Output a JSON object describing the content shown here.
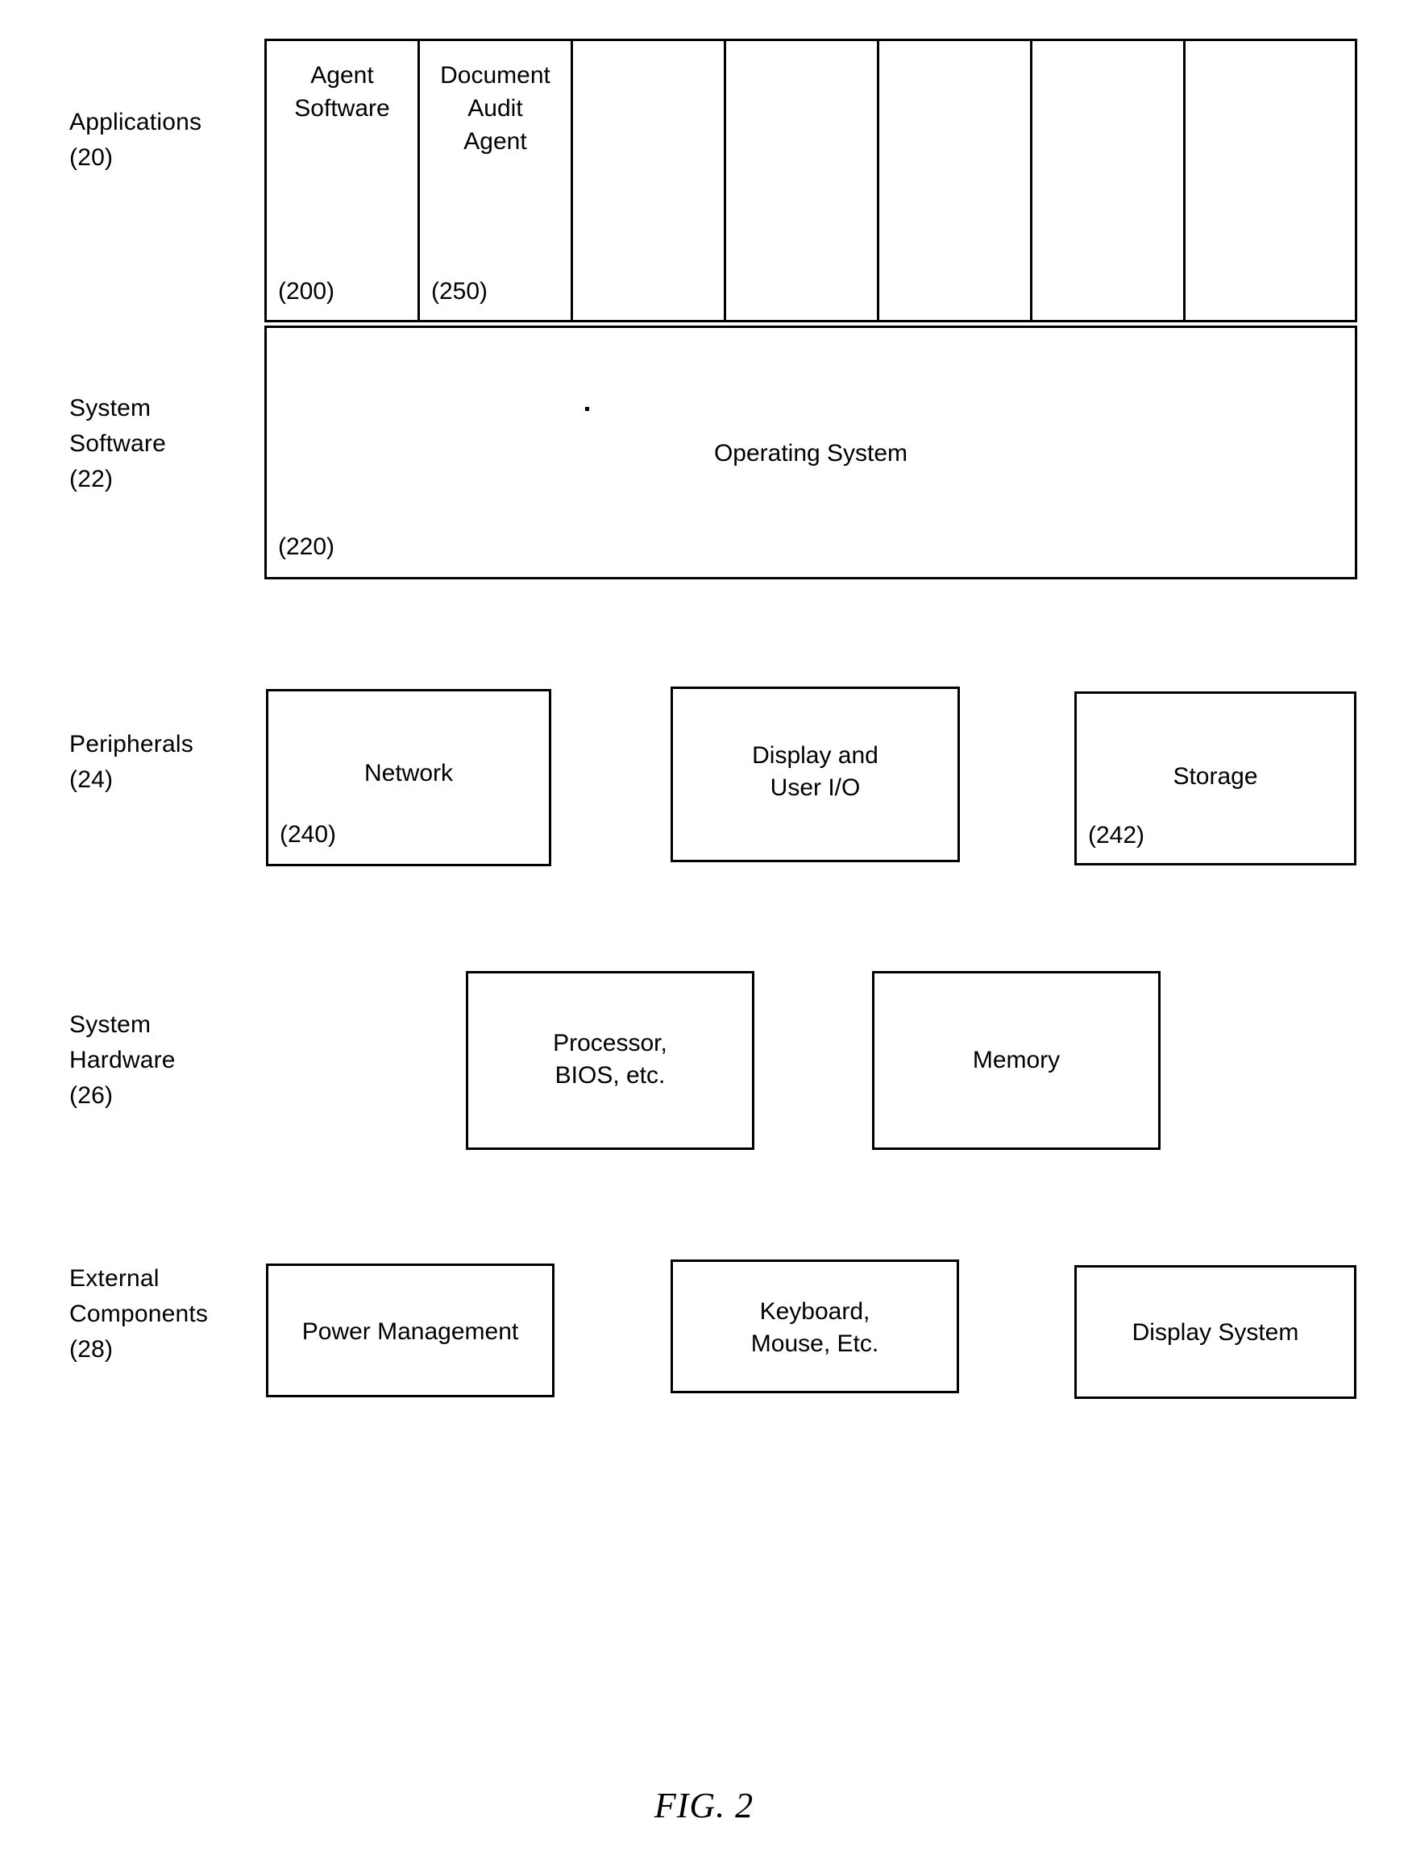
{
  "figure": {
    "caption": "FIG. 2"
  },
  "rows": [
    {
      "id": "applications",
      "label": "Applications\n(20)"
    },
    {
      "id": "system-software",
      "label": "System\nSoftware\n(22)"
    },
    {
      "id": "peripherals",
      "label": "Peripherals\n(24)"
    },
    {
      "id": "system-hardware",
      "label": "System\nHardware\n(26)"
    },
    {
      "id": "external-components",
      "label": "External\nComponents\n(28)"
    }
  ],
  "applications": {
    "cells": [
      {
        "title": "Agent\nSoftware",
        "ref": "(200)"
      },
      {
        "title": "Document\nAudit\nAgent",
        "ref": "(250)"
      },
      {
        "title": "",
        "ref": ""
      },
      {
        "title": "",
        "ref": ""
      },
      {
        "title": "",
        "ref": ""
      },
      {
        "title": "",
        "ref": ""
      },
      {
        "title": "",
        "ref": ""
      }
    ]
  },
  "system_software": {
    "os": {
      "title": "Operating System",
      "ref": "(220)"
    }
  },
  "peripherals": {
    "boxes": [
      {
        "title": "Network",
        "ref": "(240)"
      },
      {
        "title": "Display and\nUser I/O",
        "ref": ""
      },
      {
        "title": "Storage",
        "ref": "(242)"
      }
    ]
  },
  "system_hardware": {
    "boxes": [
      {
        "title": "Processor,\nBIOS, etc.",
        "ref": ""
      },
      {
        "title": "Memory",
        "ref": ""
      }
    ]
  },
  "external_components": {
    "boxes": [
      {
        "title": "Power Management",
        "ref": ""
      },
      {
        "title": "Keyboard,\nMouse, Etc.",
        "ref": ""
      },
      {
        "title": "Display System",
        "ref": ""
      }
    ]
  },
  "colors": {
    "ink": "#000000",
    "paper": "#ffffff"
  }
}
